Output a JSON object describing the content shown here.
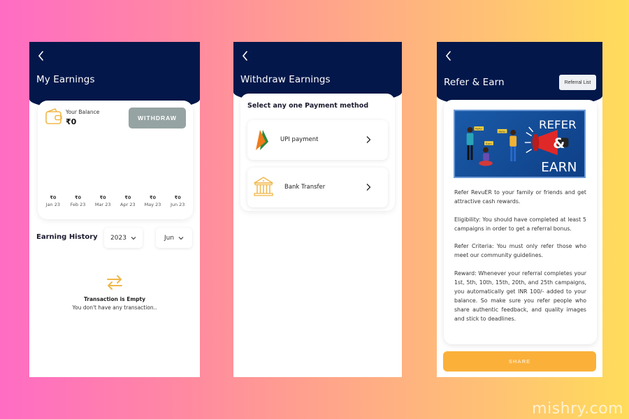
{
  "screens": {
    "earnings": {
      "title": "My Earnings",
      "balance_label": "Your Balance",
      "balance_value": "₹0",
      "withdraw_label": "WITHDRAW",
      "months": [
        {
          "value": "₹0",
          "label": "Jan 23"
        },
        {
          "value": "₹0",
          "label": "Feb 23"
        },
        {
          "value": "₹0",
          "label": "Mar 23"
        },
        {
          "value": "₹0",
          "label": "Apr 23"
        },
        {
          "value": "₹0",
          "label": "May 23"
        },
        {
          "value": "₹0",
          "label": "Jun 23"
        }
      ],
      "history_title": "Earning History",
      "year_selected": "2023",
      "month_selected": "Jun",
      "empty_title": "Transaction is Empty",
      "empty_subtitle": "You don't have any transaction.."
    },
    "withdraw": {
      "title": "Withdraw Earnings",
      "panel_title": "Select any one Payment method",
      "methods": [
        {
          "label": "UPI payment",
          "icon": "upi-logo-icon"
        },
        {
          "label": "Bank Transfer",
          "icon": "bank-icon"
        }
      ]
    },
    "refer": {
      "title": "Refer & Earn",
      "referral_list_label": "Referral List",
      "banner": {
        "bubble1": "Refer",
        "bubble2": "Refer",
        "bubble3": "Earn",
        "line1": "REFER",
        "line2": "&",
        "line3": "EARN"
      },
      "paragraphs": [
        "Refer RevuER to your family or friends and get attractive cash rewards.",
        "Eligibility: You should have completed at least 5 campaigns in order to get a referral bonus.",
        "Refer Criteria: You must only refer those who meet our community guidelines.",
        "Reward: Whenever your referral completes your 1st, 5th, 10th, 15th, 20th, and 25th campaigns, you automatically get INR 100/- added to your balance. So make sure you refer people who share authentic feedback, and quality images and stick to deadlines."
      ],
      "share_label": "SHARE"
    }
  },
  "colors": {
    "header_navy": "#03174a",
    "accent_orange": "#fbb03a",
    "withdraw_gray": "#96a3a3",
    "icon_gold": "#f0b84a"
  },
  "watermark": "mishry.com"
}
